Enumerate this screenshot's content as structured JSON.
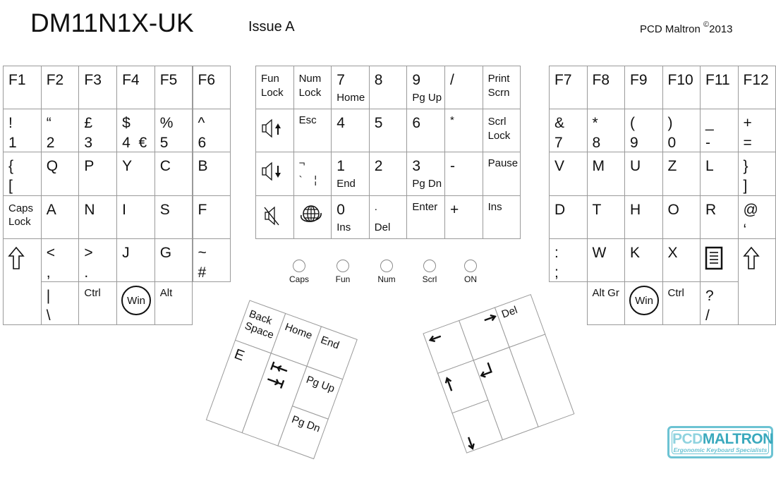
{
  "header": {
    "title": "DM11N1X-UK",
    "issue": "Issue A",
    "company": "PCD Maltron",
    "copyright_symbol": "©",
    "year": "2013"
  },
  "left_block": {
    "rows": [
      [
        {
          "top": "F1"
        },
        {
          "top": "F2"
        },
        {
          "top": "F3"
        },
        {
          "top": "F4"
        },
        {
          "top": "F5"
        },
        {
          "top": "F6"
        }
      ],
      [
        {
          "top": "!",
          "bottom": "1"
        },
        {
          "top": "“",
          "bottom": "2"
        },
        {
          "top": "£",
          "bottom": "3"
        },
        {
          "top": "$",
          "bottom": "4  €"
        },
        {
          "top": "%",
          "bottom": "5"
        },
        {
          "top": "^",
          "bottom": "6"
        }
      ],
      [
        {
          "top": "{",
          "bottom": "["
        },
        {
          "top": "Q"
        },
        {
          "top": "P"
        },
        {
          "top": "Y"
        },
        {
          "top": "C"
        },
        {
          "top": "B"
        }
      ],
      [
        {
          "top": "Caps\nLock",
          "small": true
        },
        {
          "top": "A"
        },
        {
          "top": "N"
        },
        {
          "top": "I"
        },
        {
          "top": "S"
        },
        {
          "top": "F"
        }
      ],
      [
        {
          "icon": "shift-arrow"
        },
        {
          "top": "<",
          "bottom": ","
        },
        {
          "top": ">",
          "bottom": "."
        },
        {
          "top": "J"
        },
        {
          "top": "G"
        },
        {
          "top": "~",
          "bottom": "#"
        }
      ],
      [
        {
          "top": "|",
          "bottom": "\\"
        },
        {
          "top": "Ctrl",
          "small": true
        },
        {
          "win": "Win"
        },
        {
          "top": "Alt",
          "small": true
        }
      ]
    ]
  },
  "middle_block": {
    "rows": [
      [
        {
          "top": "Fun\nLock",
          "small": true
        },
        {
          "top": "Num\nLock",
          "small": true
        },
        {
          "top": "7",
          "sub": "Home"
        },
        {
          "top": "8"
        },
        {
          "top": "9",
          "sub": "Pg Up"
        },
        {
          "top": "/"
        },
        {
          "top": "Print\nScrn",
          "small": true
        }
      ],
      [
        {
          "icon": "volume-up"
        },
        {
          "top": "Esc",
          "small": true
        },
        {
          "top": "4"
        },
        {
          "top": "5"
        },
        {
          "top": "6"
        },
        {
          "top": "*",
          "small": true
        },
        {
          "top": "Scrl\nLock",
          "small": true
        }
      ],
      [
        {
          "icon": "volume-down"
        },
        {
          "top": "¬",
          "bottom": "`    ¦",
          "small": true
        },
        {
          "top": "1",
          "sub": "End"
        },
        {
          "top": "2"
        },
        {
          "top": "3",
          "sub": "Pg Dn"
        },
        {
          "top": "-"
        },
        {
          "top": "Pause",
          "small": true
        }
      ],
      [
        {
          "icon": "mute"
        },
        {
          "icon": "internet"
        },
        {
          "top": "0",
          "sub": "Ins"
        },
        {
          "top": ".",
          "sub": "Del",
          "small": true
        },
        {
          "top": "Enter",
          "small": true
        },
        {
          "top": "+"
        },
        {
          "top": "Ins",
          "small": true
        }
      ]
    ]
  },
  "right_block": {
    "rows": [
      [
        {
          "top": "F7"
        },
        {
          "top": "F8"
        },
        {
          "top": "F9"
        },
        {
          "top": "F10"
        },
        {
          "top": "F11"
        },
        {
          "top": "F12"
        }
      ],
      [
        {
          "top": "&",
          "bottom": "7"
        },
        {
          "top": "*",
          "bottom": "8"
        },
        {
          "top": "(",
          "bottom": "9"
        },
        {
          "top": ")",
          "bottom": "0"
        },
        {
          "top": "_",
          "bottom": "-"
        },
        {
          "top": "+",
          "bottom": "="
        }
      ],
      [
        {
          "top": "V"
        },
        {
          "top": "M"
        },
        {
          "top": "U"
        },
        {
          "top": "Z"
        },
        {
          "top": "L"
        },
        {
          "top": "}",
          "bottom": "]"
        }
      ],
      [
        {
          "top": "D"
        },
        {
          "top": "T"
        },
        {
          "top": "H"
        },
        {
          "top": "O"
        },
        {
          "top": "R"
        },
        {
          "top": "@",
          "bottom": "‘"
        }
      ],
      [
        {
          "top": ":",
          "bottom": ";"
        },
        {
          "top": "W"
        },
        {
          "top": "K"
        },
        {
          "top": "X"
        },
        {
          "icon": "menu"
        },
        {
          "icon": "shift-arrow"
        }
      ],
      [
        {
          "top": "Alt Gr",
          "small": true
        },
        {
          "win": "Win"
        },
        {
          "top": "Ctrl",
          "small": true
        },
        {
          "top": "?",
          "bottom": "/"
        }
      ]
    ]
  },
  "indicators": [
    "Caps",
    "Fun",
    "Num",
    "Scrl",
    "ON"
  ],
  "left_thumb": {
    "keys": [
      "Back\nSpace",
      "Home",
      "End",
      "E",
      "tab-icon",
      "Pg Up",
      "Pg Dn"
    ]
  },
  "right_thumb": {
    "keys": [
      "left-arrow",
      "right-arrow",
      "Del",
      "up-arrow",
      "enter-icon",
      "",
      "down-arrow"
    ]
  },
  "logo": {
    "part1": "PCD",
    "part2": "MALTRON",
    "tagline": "Ergonomic Keyboard Specialists"
  },
  "colors": {
    "border": "#9a9a9a",
    "logo_accent": "#3aa9bd"
  }
}
